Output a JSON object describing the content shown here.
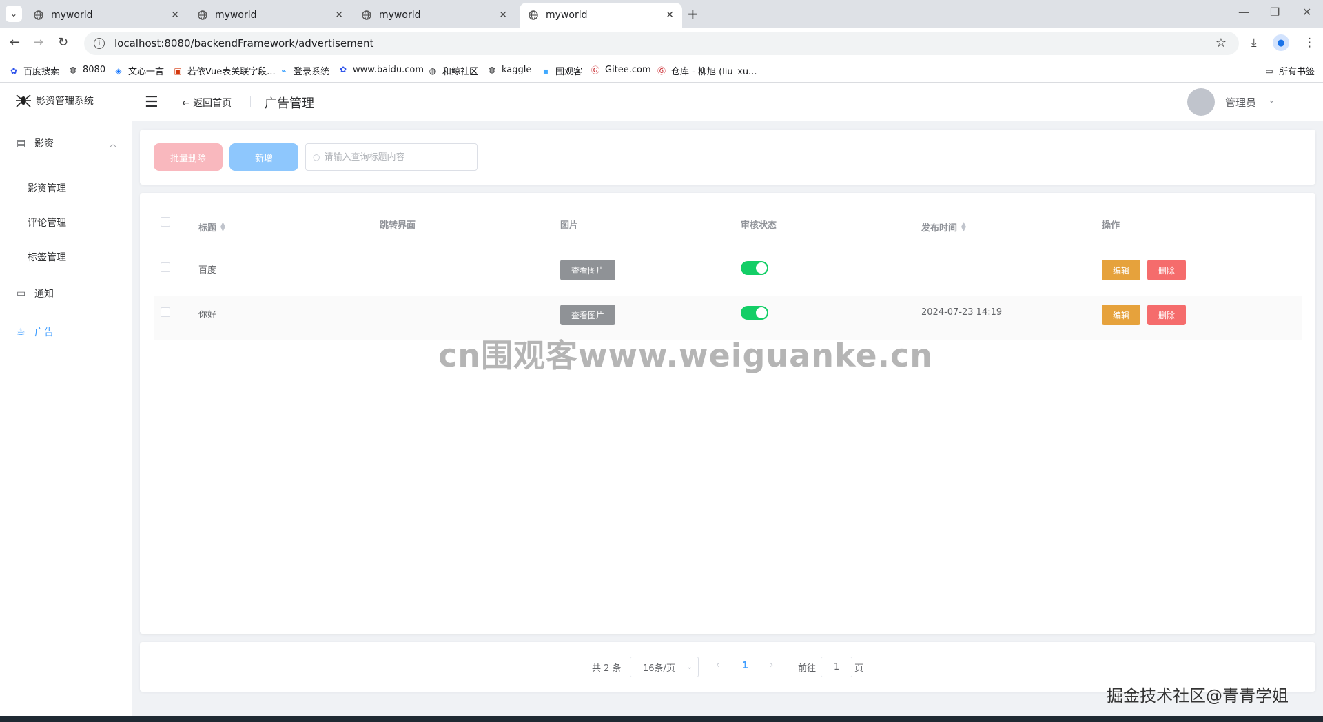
{
  "browser": {
    "tabs": [
      {
        "title": "myworld",
        "active": false
      },
      {
        "title": "myworld",
        "active": false
      },
      {
        "title": "myworld",
        "active": false
      },
      {
        "title": "myworld",
        "active": true
      }
    ],
    "url": "localhost:8080/backendFramework/advertisement",
    "bookmarks": [
      {
        "label": "百度搜索",
        "icon": "paw-icon"
      },
      {
        "label": "8080",
        "icon": "globe-icon"
      },
      {
        "label": "文心一言",
        "icon": "cube-icon"
      },
      {
        "label": "若依Vue表关联字段...",
        "icon": "ruoyi-icon"
      },
      {
        "label": "登录系统",
        "icon": "login-icon"
      },
      {
        "label": "www.baidu.com",
        "icon": "paw-icon"
      },
      {
        "label": "和鲸社区",
        "icon": "globe-icon"
      },
      {
        "label": "kaggle",
        "icon": "globe-icon"
      },
      {
        "label": "围观客",
        "icon": "flag-icon"
      },
      {
        "label": "Gitee.com",
        "icon": "gitee-icon"
      },
      {
        "label": "仓库 - 柳旭 (liu_xu...",
        "icon": "gitee-icon"
      }
    ],
    "all_bookmarks": "所有书签"
  },
  "app": {
    "name": "影资管理系统",
    "menu": {
      "group1": "影资",
      "sub_items": [
        "影资管理",
        "评论管理",
        "标签管理"
      ],
      "group2": "通知",
      "group3": "广告"
    },
    "header": {
      "back": "返回首页",
      "title": "广告管理",
      "user": "管理员"
    },
    "toolbar": {
      "batch_delete": "批量删除",
      "add": "新增",
      "search_placeholder": "请输入查询标题内容"
    },
    "table": {
      "columns": [
        "标题",
        "跳转界面",
        "图片",
        "审核状态",
        "发布时间",
        "操作"
      ],
      "rows": [
        {
          "title": "百度",
          "jump": "",
          "image_btn": "查看图片",
          "status_on": true,
          "time": "",
          "edit": "编辑",
          "delete": "删除"
        },
        {
          "title": "你好",
          "jump": "",
          "image_btn": "查看图片",
          "status_on": true,
          "time": "2024-07-23 14:19",
          "edit": "编辑",
          "delete": "删除"
        }
      ]
    },
    "pagination": {
      "total": "共 2 条",
      "page_size": "16条/页",
      "current_page": "1",
      "goto_label": "前往",
      "goto_value": "1",
      "page_suffix": "页"
    },
    "colors": {
      "primary": "#409eff",
      "switch_on": "#13ce66",
      "edit": "#e6a23c",
      "delete": "#f56c6c"
    }
  },
  "watermarks": {
    "center": "cn围观客www.weiguanke.cn",
    "corner": "掘金技术社区@青青学姐"
  }
}
